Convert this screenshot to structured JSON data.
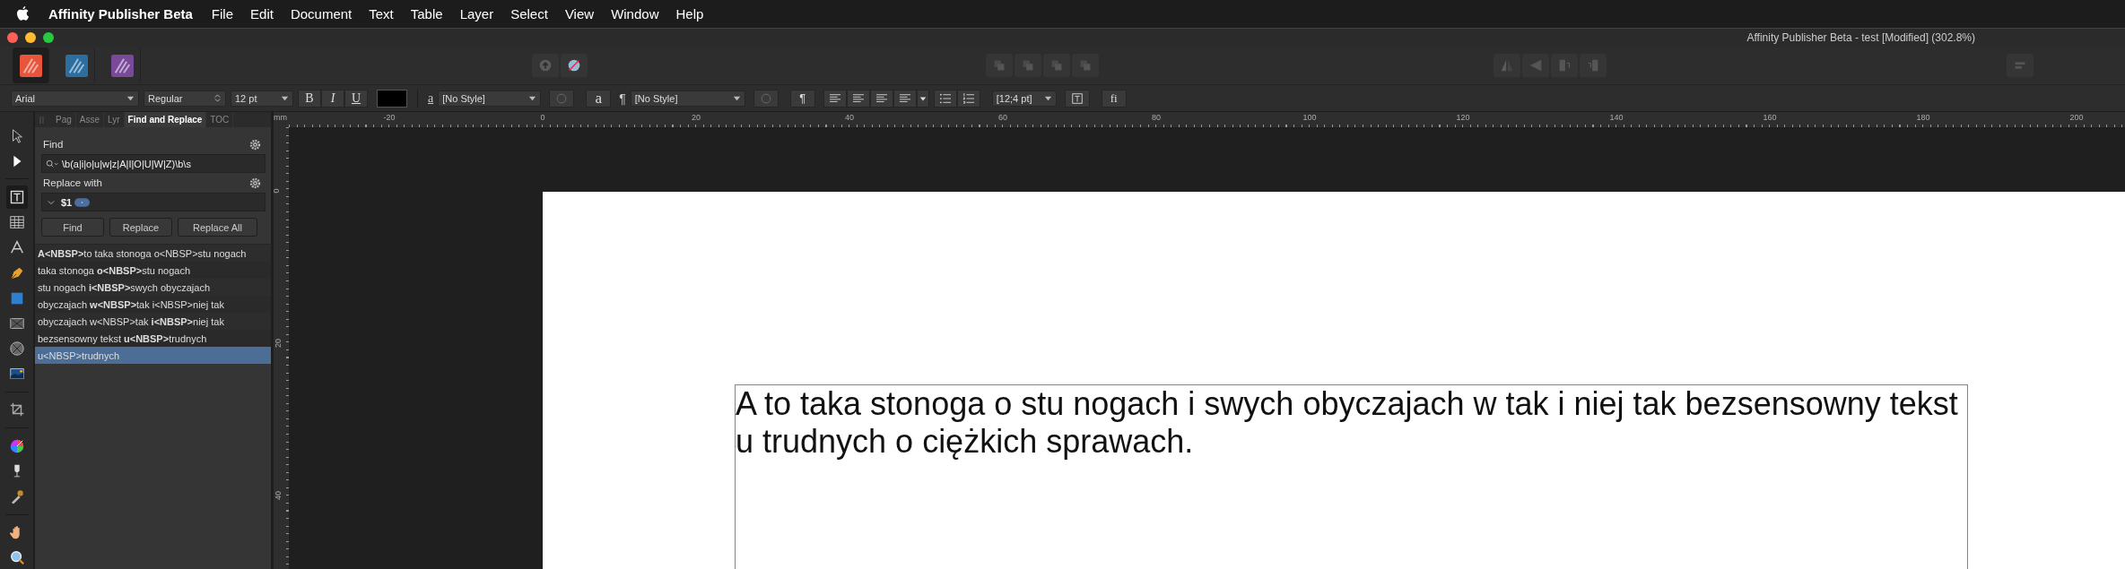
{
  "menubar": {
    "app": "Affinity Publisher Beta",
    "items": [
      "File",
      "Edit",
      "Document",
      "Text",
      "Table",
      "Layer",
      "Select",
      "View",
      "Window",
      "Help"
    ]
  },
  "window": {
    "title": "Affinity Publisher Beta - test [Modified] (302.8%)"
  },
  "personas": [
    {
      "kind": "publisher",
      "selected": true
    },
    {
      "kind": "designer",
      "selected": false
    },
    {
      "kind": "photo",
      "selected": false
    }
  ],
  "context_toolbar": {
    "font": "Arial",
    "style": "Regular",
    "size": "12 pt",
    "bold": "B",
    "italic": "I",
    "underline": "U",
    "char_icon": "a",
    "character_style": "[No Style]",
    "char_button": "a",
    "para_icon": "¶",
    "paragraph_style": "[No Style]",
    "para_button": "¶",
    "spacing": "[12;4 pt]",
    "ligature": "fi"
  },
  "tool_groups": [
    [
      {
        "kind": "pointer",
        "selected": false
      },
      {
        "kind": "node",
        "selected": false
      }
    ],
    [
      {
        "kind": "frame-text",
        "selected": true
      },
      {
        "kind": "table",
        "selected": false
      },
      {
        "kind": "artistic-text",
        "selected": false
      },
      {
        "kind": "pen",
        "selected": false
      },
      {
        "kind": "rectangle",
        "selected": false
      },
      {
        "kind": "picture-frame",
        "selected": false
      },
      {
        "kind": "ellipse-frame",
        "selected": false
      },
      {
        "kind": "place-image",
        "selected": false
      }
    ],
    [
      {
        "kind": "crop",
        "selected": false
      }
    ],
    [
      {
        "kind": "color-wheel",
        "selected": false
      },
      {
        "kind": "glass",
        "selected": false
      },
      {
        "kind": "eyedropper",
        "selected": false
      }
    ],
    [
      {
        "kind": "hand",
        "selected": false
      },
      {
        "kind": "zoom",
        "selected": false
      }
    ]
  ],
  "panel_tabs": [
    {
      "label": "Pag",
      "selected": false
    },
    {
      "label": "Asse",
      "selected": false
    },
    {
      "label": "Lyr",
      "selected": false
    },
    {
      "label": "Find and Replace",
      "selected": true
    },
    {
      "label": "TOC",
      "selected": false
    }
  ],
  "find": {
    "label": "Find",
    "value": "\\b(a|i|o|u|w|z|A|I|O|U|W|Z)\\b\\s"
  },
  "replace": {
    "label": "Replace with",
    "value": "$1"
  },
  "buttons": [
    "Find",
    "Replace",
    "Replace All"
  ],
  "results": [
    {
      "text": "**A<NBSP>**to taka stonoga o<NBSP>stu nogach",
      "selected": false
    },
    {
      "text": "taka stonoga **o<NBSP>**stu nogach",
      "selected": false
    },
    {
      "text": "stu nogach **i<NBSP>**swych obyczajach",
      "selected": false
    },
    {
      "text": "obyczajach **w<NBSP>**tak i<NBSP>niej tak",
      "selected": false
    },
    {
      "text": "obyczajach w<NBSP>tak **i<NBSP>**niej tak",
      "selected": false
    },
    {
      "text": "bezsensowny tekst **u<NBSP>**trudnych",
      "selected": false
    },
    {
      "text": "u<NBSP>trudnych",
      "selected": true
    }
  ],
  "rulers": {
    "unit": "mm",
    "horizontal": [
      "-20",
      "0",
      "20",
      "40",
      "60",
      "80",
      "100",
      "120",
      "140",
      "160",
      "180",
      "200"
    ],
    "vertical": [
      "0",
      "20",
      "40"
    ]
  },
  "document": {
    "text": "A to taka stonoga o stu nogach i swych obyczajach w tak i niej tak bezsensowny tekst u trudnych o ciężkich sprawach."
  }
}
